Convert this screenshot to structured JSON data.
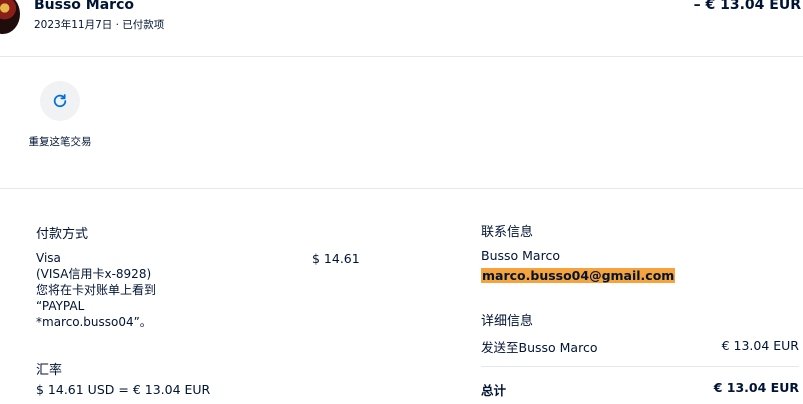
{
  "header": {
    "merchant_name": "Busso Marco",
    "date_status": "2023年11月7日 · 已付款项",
    "amount": "– € 13.04 EUR"
  },
  "actions": {
    "repeat_label": "重复这笔交易",
    "repeat_icon": "refresh-icon"
  },
  "payment": {
    "title": "付款方式",
    "method_lines": [
      "Visa",
      "(VISA信用卡x-8928)",
      "您将在卡对账单上看到",
      "“PAYPAL",
      "*marco.busso04”。"
    ],
    "amount": "$ 14.61"
  },
  "exchange": {
    "title": "汇率",
    "value": "$ 14.61 USD = € 13.04 EUR"
  },
  "contact": {
    "title": "联系信息",
    "name": "Busso Marco",
    "email": "marco.busso04@gmail.com"
  },
  "details": {
    "title": "详细信息",
    "ship_label": "发送至Busso Marco",
    "ship_amount": "€ 13.04 EUR",
    "total_label": "总计",
    "total_amount": "€ 13.04 EUR"
  },
  "colors": {
    "text": "#001435",
    "highlight": "#f5a33a",
    "divider": "#e6e9ec",
    "button_bg": "#f1f2f4",
    "icon": "#0070e0"
  }
}
